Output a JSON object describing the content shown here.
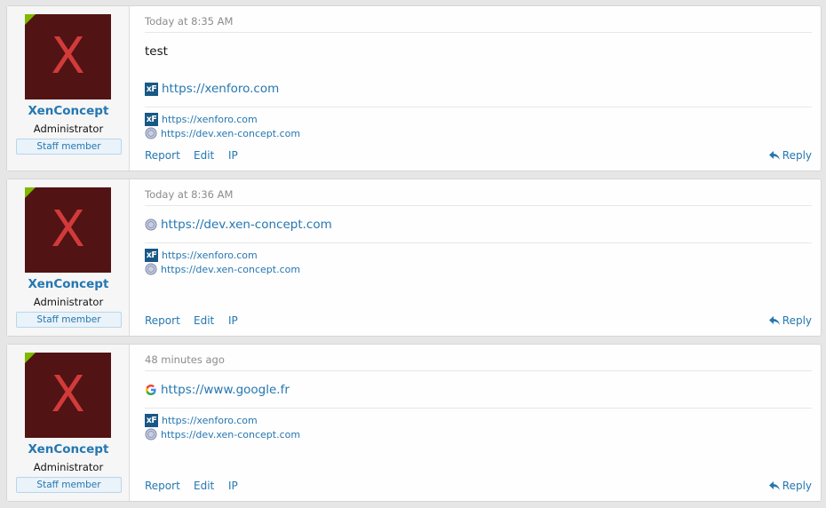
{
  "posts": [
    {
      "avatar_letter": "X",
      "username": "XenConcept",
      "user_title": "Administrator",
      "badge": "Staff member",
      "date": "Today at 8:35 AM",
      "text": "test",
      "unfurl": {
        "icon": "xenforo-icon",
        "url": "https://xenforo.com"
      },
      "links": [
        {
          "icon": "xenforo-icon",
          "url": "https://xenforo.com"
        },
        {
          "icon": "globe-icon",
          "url": "https://dev.xen-concept.com"
        }
      ],
      "actions": [
        "Report",
        "Edit",
        "IP"
      ],
      "reply": "Reply"
    },
    {
      "avatar_letter": "X",
      "username": "XenConcept",
      "user_title": "Administrator",
      "badge": "Staff member",
      "date": "Today at 8:36 AM",
      "unfurl": {
        "icon": "globe-icon",
        "url": "https://dev.xen-concept.com"
      },
      "links": [
        {
          "icon": "xenforo-icon",
          "url": "https://xenforo.com"
        },
        {
          "icon": "globe-icon",
          "url": "https://dev.xen-concept.com"
        }
      ],
      "actions": [
        "Report",
        "Edit",
        "IP"
      ],
      "reply": "Reply"
    },
    {
      "avatar_letter": "X",
      "username": "XenConcept",
      "user_title": "Administrator",
      "badge": "Staff member",
      "date": "48 minutes ago",
      "unfurl": {
        "icon": "google-icon",
        "url": "https://www.google.fr"
      },
      "links": [
        {
          "icon": "xenforo-icon",
          "url": "https://xenforo.com"
        },
        {
          "icon": "globe-icon",
          "url": "https://dev.xen-concept.com"
        }
      ],
      "actions": [
        "Report",
        "Edit",
        "IP"
      ],
      "reply": "Reply"
    }
  ],
  "colors": {
    "link": "#2577b1",
    "avatar_bg": "#521315",
    "avatar_letter": "#d23b3a",
    "online": "#7fb900"
  }
}
